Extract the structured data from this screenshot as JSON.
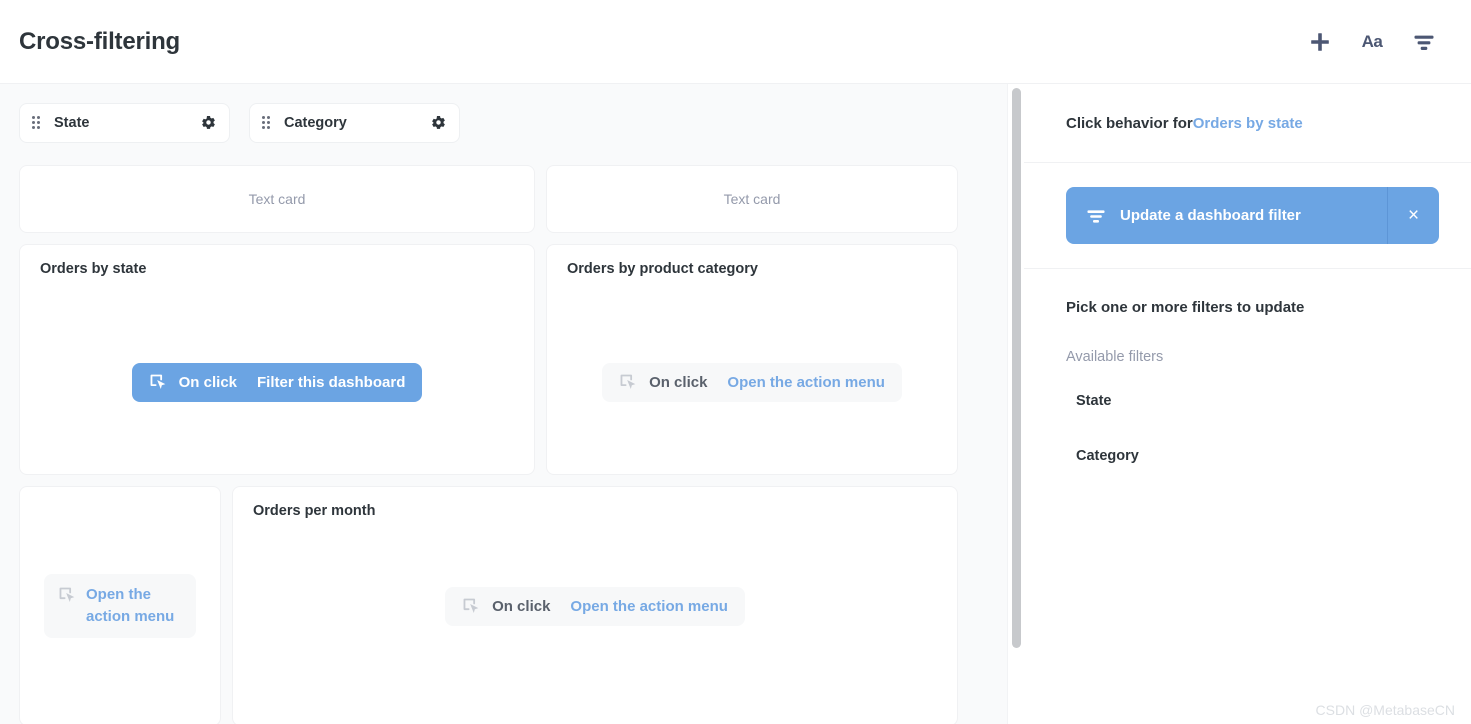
{
  "header": {
    "title": "Cross-filtering",
    "actions": [
      {
        "name": "add-icon",
        "glyph": "+"
      },
      {
        "name": "text-format-icon",
        "glyph": "Aa"
      },
      {
        "name": "filter-icon",
        "glyph": "filter"
      }
    ]
  },
  "filters": [
    {
      "label": "State"
    },
    {
      "label": "Category"
    }
  ],
  "dashboard": {
    "text_cards": [
      {
        "label": "Text card"
      },
      {
        "label": "Text card"
      }
    ],
    "cards": [
      {
        "title": "Orders by state",
        "on_click_label": "On click",
        "action_label": "Filter this dashboard",
        "active": true
      },
      {
        "title": "Orders by product category",
        "on_click_label": "On click",
        "action_label": "Open the action menu",
        "active": false
      },
      {
        "title": "",
        "on_click_label": "",
        "action_label": "Open the action menu",
        "active": false
      },
      {
        "title": "Orders per month",
        "on_click_label": "On click",
        "action_label": "Open the action menu",
        "active": false
      }
    ]
  },
  "sidebar": {
    "heading_prefix": "Click behavior for ",
    "heading_card": "Orders by state",
    "selected_behavior": "Update a dashboard filter",
    "close_glyph": "×",
    "prompt": "Pick one or more filters to update",
    "available_label": "Available filters",
    "available_filters": [
      {
        "label": "State"
      },
      {
        "label": "Category"
      }
    ]
  },
  "watermark": "CSDN @MetabaseCN",
  "colors": {
    "accent_blue": "#6ba4e3",
    "link_blue": "#77a9e4",
    "text_dark": "#2e353b",
    "text_muted": "#949aab",
    "canvas": "#f9fafb"
  }
}
